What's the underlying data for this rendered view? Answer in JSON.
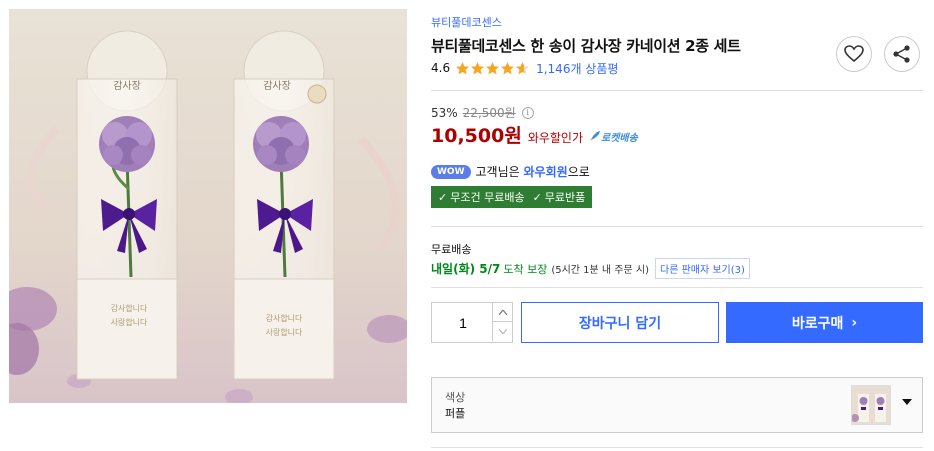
{
  "product": {
    "brand": "뷰티풀데코센스",
    "title": "뷰티풀데코센스 한 송이 감사장 카네이션 2종 세트",
    "rating": "4.6",
    "rating_value": 4.6,
    "rating_max": 5,
    "review_count": "1,146개 상품평"
  },
  "price": {
    "discount_rate": "53%",
    "original": "22,500원",
    "sale": "10,500원",
    "wow_label": "와우할인가",
    "rocket_label": "로켓배송"
  },
  "membership": {
    "badge": "WOW",
    "text_prefix": "고객님은",
    "member_link": "와우회원",
    "text_suffix": "으로"
  },
  "benefits": {
    "free_shipping": "무조건 무료배송",
    "free_return": "무료반품"
  },
  "delivery": {
    "title": "무료배송",
    "arrival": "내일(화) 5/7",
    "arrival_suffix": "도착 보장",
    "cutoff": "(5시간 1분 내 주문 시)",
    "other_sellers": "다른 판매자 보기(3)"
  },
  "purchase": {
    "quantity": "1",
    "cart_label": "장바구니 담기",
    "buy_label": "바로구매"
  },
  "option": {
    "label": "색상",
    "value": "퍼플"
  },
  "image_text": {
    "card_title": "감사장",
    "box_line1": "감사합니다",
    "box_line2": "사랑합니다"
  },
  "colors": {
    "accent": "#346aff",
    "price_red": "#ae0000",
    "delivery_green": "#00891a",
    "benefit_green": "#2e7d32",
    "star": "#f5a623"
  },
  "icons": {
    "wish": "heart-icon",
    "share": "share-icon",
    "info": "info-icon",
    "rocket": "rocket-icon",
    "check": "check-icon",
    "caret": "caret-down-icon"
  }
}
